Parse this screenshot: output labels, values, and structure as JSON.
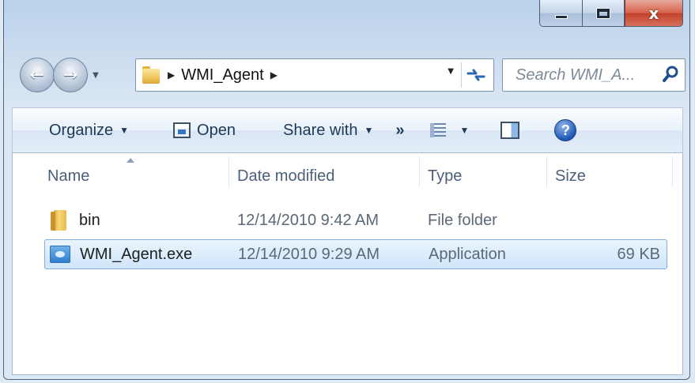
{
  "window": {
    "caption": {
      "minimize_icon": "minimize-icon",
      "maximize_icon": "maximize-icon",
      "close_icon": "close-icon",
      "close_glyph": "x"
    }
  },
  "nav": {
    "back_glyph": "←",
    "forward_glyph": "→",
    "address": {
      "breadcrumbs": [
        "WMI_Agent"
      ],
      "separator": "▶"
    },
    "search": {
      "placeholder": "Search WMI_A..."
    }
  },
  "toolbar": {
    "organize": "Organize",
    "open": "Open",
    "share_with": "Share with",
    "more": "»",
    "dropdown_glyph": "▼",
    "help_glyph": "?"
  },
  "columns": {
    "name": "Name",
    "date_modified": "Date modified",
    "type": "Type",
    "size": "Size"
  },
  "files": [
    {
      "name": "bin",
      "date": "12/14/2010 9:42 AM",
      "type": "File folder",
      "size": "",
      "icon": "folder-icon",
      "selected": false
    },
    {
      "name": "WMI_Agent.exe",
      "date": "12/14/2010 9:29 AM",
      "type": "Application",
      "size": "69 KB",
      "icon": "application-icon",
      "selected": true
    }
  ],
  "colors": {
    "accent": "#3574c3",
    "selection_border": "#84acdd",
    "close_button": "#c2402a"
  }
}
